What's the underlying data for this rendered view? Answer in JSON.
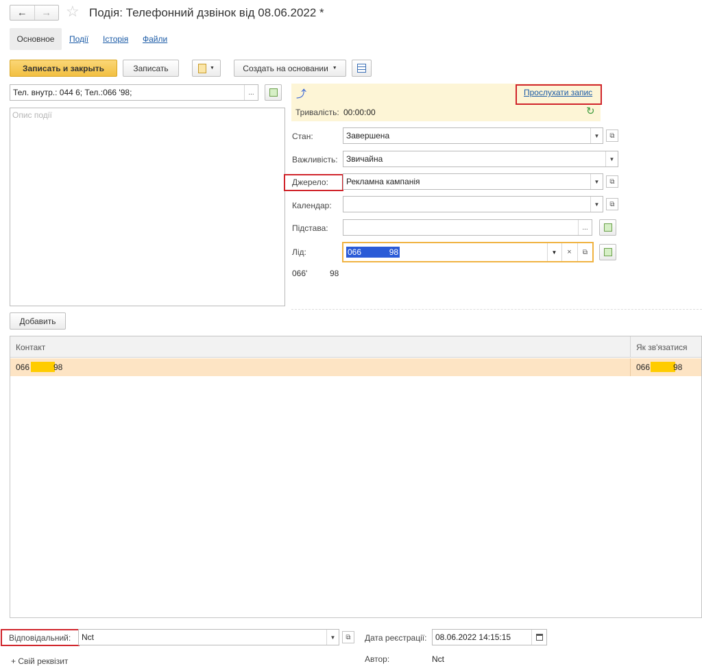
{
  "window": {
    "title": "Подія: Телефонний дзвінок від 08.06.2022 *"
  },
  "tabs": [
    {
      "label": "Основное"
    },
    {
      "label": "Події"
    },
    {
      "label": "Історія"
    },
    {
      "label": "Файли"
    }
  ],
  "toolbar": {
    "save_close": "Записать и закрыть",
    "save": "Записать",
    "create_based": "Создать на основании"
  },
  "left": {
    "phone_field": "Тел. внутр.: 044          6; Тел.:066          '98;",
    "description_placeholder": "Опис події",
    "ellipsis": "..."
  },
  "call": {
    "listen_link": "Прослухати запис",
    "duration_label": "Тривалість:",
    "duration_value": "00:00:00"
  },
  "form": {
    "status_label": "Стан:",
    "status_value": "Завершена",
    "importance_label": "Важливість:",
    "importance_value": "Звичайна",
    "source_label": "Джерело:",
    "source_value": "Рекламна кампанія",
    "calendar_label": "Календар:",
    "calendar_value": "",
    "basis_label": "Підстава:",
    "basis_value": "",
    "lead_label": "Лід:",
    "lead_value_start": "066",
    "lead_value_end": "98",
    "lead_text_start": "066'",
    "lead_text_end": "98"
  },
  "contacts": {
    "add_button": "Добавить",
    "columns": [
      "Контакт",
      "Як зв'язатися"
    ],
    "rows": [
      {
        "contact_start": "066",
        "contact_end": "98",
        "how_start": "066",
        "how_end": "98"
      }
    ]
  },
  "footer": {
    "responsible_label": "Відповідальний:",
    "responsible_value": "Nct",
    "reg_date_label": "Дата реєстрації:",
    "reg_date_value": "08.06.2022 14:15:15",
    "author_label": "Автор:",
    "author_value": "Nct",
    "add_attr_link": "+ Свій реквізит"
  },
  "colors": {
    "accent_yellow": "#f2c042",
    "highlight_bg": "#fdf5d6",
    "selected_row": "#fde4c4",
    "link": "#1a5aa6",
    "annotation_red": "#d0232a",
    "focus_border": "#f0b240"
  }
}
